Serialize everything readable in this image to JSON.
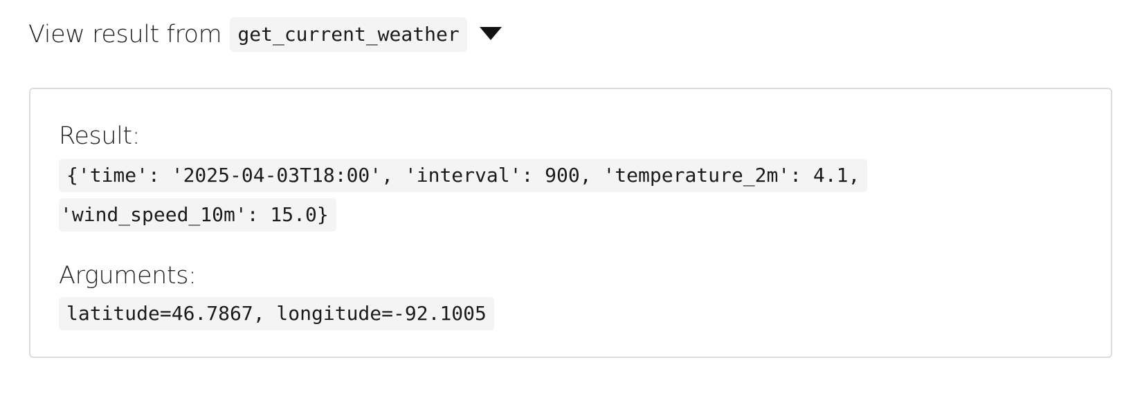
{
  "summary": {
    "label": "View result from",
    "tool_name": "get_current_weather",
    "toggle_icon": "caret-down-icon"
  },
  "result": {
    "label": "Result:",
    "lines": [
      "{'time': '2025-04-03T18:00', 'interval': 900, 'temperature_2m': 4.1,",
      "'wind_speed_10m': 15.0}"
    ]
  },
  "arguments": {
    "label": "Arguments:",
    "value": "latitude=46.7867, longitude=-92.1005"
  },
  "colors": {
    "code_background": "#f4f4f4",
    "panel_border": "#dcdcdc",
    "text": "#222222"
  }
}
